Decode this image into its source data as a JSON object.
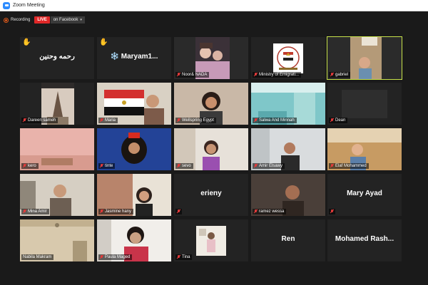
{
  "window": {
    "title": "Zoom Meeting"
  },
  "toolbar": {
    "recording_label": "Recording",
    "live_label": "LIVE",
    "stream_label": "on Facebook",
    "stream_caret": "▾"
  },
  "tiles": [
    {
      "name": "رحمه وحنين",
      "raised_hand": true
    },
    {
      "name": "❄️ Maryam1...",
      "raised_hand": true
    },
    {
      "name": "Noor& NADA"
    },
    {
      "name": "Ministry of Emigrati..."
    },
    {
      "name": "gabriel",
      "active": true
    },
    {
      "name": "Dareen sameh"
    },
    {
      "name": "Maria"
    },
    {
      "name": "Wellspring Egypt"
    },
    {
      "name": "Salwa And Minnah"
    },
    {
      "name": "Dean"
    },
    {
      "name": "kero"
    },
    {
      "name": "tinte"
    },
    {
      "name": "sevo"
    },
    {
      "name": "Amir Elsawy"
    },
    {
      "name": "Elaf Mohammed"
    },
    {
      "name": "Mina Amir"
    },
    {
      "name": "Jasmine hany"
    },
    {
      "name": "erieny"
    },
    {
      "name": "ramez wessa"
    },
    {
      "name": "Mary Ayad"
    },
    {
      "name": "Nabila Makram"
    },
    {
      "name": "Paula Maged"
    },
    {
      "name": "Tina"
    },
    {
      "name": "Ren"
    },
    {
      "name": "Mohamed Rash..."
    }
  ],
  "colors": {
    "accent_active": "#c8e34a",
    "live_red": "#e02828",
    "muted_red": "#e23b3b",
    "tile_bg": "#232323",
    "raised_hand": "#f2c200"
  }
}
